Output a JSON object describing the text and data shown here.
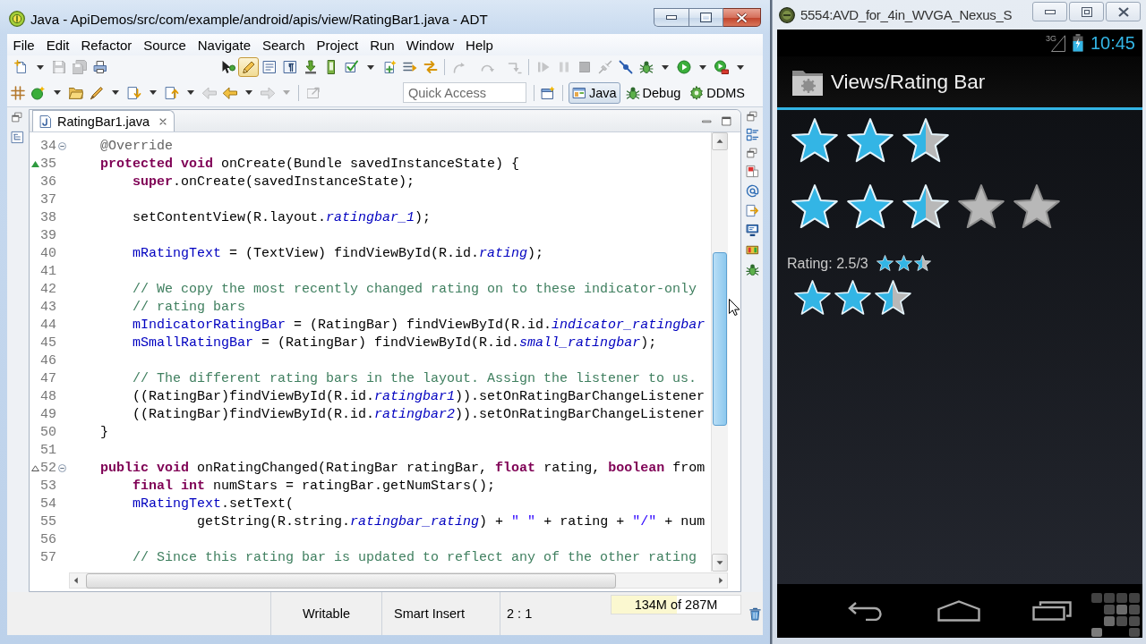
{
  "ide": {
    "title": "Java - ApiDemos/src/com/example/android/apis/view/RatingBar1.java - ADT",
    "menu": [
      "File",
      "Edit",
      "Refactor",
      "Source",
      "Navigate",
      "Search",
      "Project",
      "Run",
      "Window",
      "Help"
    ],
    "toolbar_rows": [
      {
        "groups": [
          {
            "items": [
              {
                "kind": "button",
                "disabled": false,
                "on": false
              },
              {
                "kind": "dropdown",
                "disabled": false,
                "on": false
              },
              {
                "kind": "button",
                "disabled": true,
                "on": false
              },
              {
                "kind": "button",
                "disabled": true,
                "on": false
              },
              {
                "kind": "button",
                "disabled": false,
                "on": false
              }
            ]
          },
          {
            "items": [
              {
                "kind": "button",
                "disabled": false,
                "on": false
              },
              {
                "kind": "button",
                "disabled": false,
                "on": true
              },
              {
                "kind": "button",
                "disabled": false,
                "on": false
              },
              {
                "kind": "button",
                "disabled": false,
                "on": false
              },
              {
                "kind": "button",
                "disabled": false,
                "on": false
              },
              {
                "kind": "button",
                "disabled": false,
                "on": false
              },
              {
                "kind": "button",
                "disabled": false,
                "on": false
              },
              {
                "kind": "dropdown",
                "disabled": false,
                "on": false
              },
              {
                "kind": "button",
                "disabled": false,
                "on": false
              },
              {
                "kind": "button",
                "disabled": false,
                "on": false
              },
              {
                "kind": "button",
                "disabled": false,
                "on": false
              }
            ]
          },
          {
            "items": [
              {
                "kind": "button",
                "disabled": true,
                "on": false
              },
              {
                "kind": "button",
                "disabled": true,
                "on": false
              },
              {
                "kind": "button",
                "disabled": true,
                "on": false
              }
            ]
          },
          {
            "items": [
              {
                "kind": "button",
                "disabled": true,
                "on": false
              },
              {
                "kind": "button",
                "disabled": true,
                "on": false
              },
              {
                "kind": "button",
                "disabled": true,
                "on": false
              },
              {
                "kind": "button",
                "disabled": true,
                "on": false
              },
              {
                "kind": "button",
                "disabled": false,
                "on": false
              },
              {
                "kind": "button",
                "disabled": false,
                "on": false
              },
              {
                "kind": "dropdown",
                "disabled": false,
                "on": false
              },
              {
                "kind": "button",
                "disabled": false,
                "on": false
              },
              {
                "kind": "dropdown",
                "disabled": false,
                "on": false
              },
              {
                "kind": "button",
                "disabled": false,
                "on": false
              },
              {
                "kind": "dropdown",
                "disabled": false,
                "on": false
              }
            ]
          }
        ]
      },
      {
        "groups": [
          {
            "items": [
              {
                "kind": "button",
                "disabled": false,
                "on": false
              },
              {
                "kind": "button",
                "disabled": false,
                "on": false
              },
              {
                "kind": "dropdown",
                "disabled": false,
                "on": false
              },
              {
                "kind": "button",
                "disabled": false,
                "on": false
              },
              {
                "kind": "button",
                "disabled": false,
                "on": false
              },
              {
                "kind": "dropdown",
                "disabled": false,
                "on": false
              },
              {
                "kind": "button",
                "disabled": false,
                "on": false
              },
              {
                "kind": "dropdown",
                "disabled": false,
                "on": false
              },
              {
                "kind": "button",
                "disabled": false,
                "on": false
              },
              {
                "kind": "dropdown",
                "disabled": false,
                "on": false
              },
              {
                "kind": "button",
                "disabled": true,
                "on": false
              },
              {
                "kind": "button",
                "disabled": false,
                "on": false
              },
              {
                "kind": "dropdown",
                "disabled": false,
                "on": false
              },
              {
                "kind": "button",
                "disabled": true,
                "on": false
              },
              {
                "kind": "dropdown",
                "disabled": true,
                "on": false
              }
            ]
          },
          {
            "items": [
              {
                "kind": "button",
                "disabled": true,
                "on": false
              }
            ]
          }
        ]
      }
    ],
    "quick_access": {
      "placeholder": "Quick Access"
    },
    "perspectives": [
      {
        "label": "Java",
        "selected": true
      },
      {
        "label": "Debug",
        "selected": false
      },
      {
        "label": "DDMS",
        "selected": false
      }
    ],
    "editor": {
      "tabs": [
        {
          "label": "RatingBar1.java",
          "selected": true
        }
      ],
      "lines": [
        {
          "number": "34",
          "overrides": false,
          "implements": false,
          "fold": true,
          "tokens": [
            {
              "kind": "annotation",
              "text": "    @Override"
            }
          ]
        },
        {
          "number": "35",
          "overrides": true,
          "implements": false,
          "fold": false,
          "tokens": [
            {
              "kind": "keyword",
              "text": "    protected void"
            },
            {
              "kind": "plain",
              "text": " onCreate(Bundle savedInstanceState) {"
            }
          ]
        },
        {
          "number": "36",
          "overrides": false,
          "implements": false,
          "fold": false,
          "tokens": [
            {
              "kind": "keyword",
              "text": "        super"
            },
            {
              "kind": "plain",
              "text": ".onCreate(savedInstanceState);"
            }
          ]
        },
        {
          "number": "37",
          "overrides": false,
          "implements": false,
          "fold": false
        },
        {
          "number": "38",
          "overrides": false,
          "implements": false,
          "fold": false,
          "tokens": [
            {
              "kind": "plain",
              "text": "        setContentView(R.layout."
            },
            {
              "kind": "constant",
              "text": "ratingbar_1"
            },
            {
              "kind": "plain",
              "text": ");"
            }
          ]
        },
        {
          "number": "39",
          "overrides": false,
          "implements": false,
          "fold": false
        },
        {
          "number": "40",
          "overrides": false,
          "implements": false,
          "fold": false,
          "tokens": [
            {
              "kind": "field",
              "text": "        mRatingText"
            },
            {
              "kind": "plain",
              "text": " = (TextView) findViewById(R.id."
            },
            {
              "kind": "constant",
              "text": "rating"
            },
            {
              "kind": "plain",
              "text": ");"
            }
          ]
        },
        {
          "number": "41",
          "overrides": false,
          "implements": false,
          "fold": false
        },
        {
          "number": "42",
          "overrides": false,
          "implements": false,
          "fold": false,
          "tokens": [
            {
              "kind": "comment",
              "text": "        // We copy the most recently changed rating on to these indicator-only"
            }
          ]
        },
        {
          "number": "43",
          "overrides": false,
          "implements": false,
          "fold": false,
          "tokens": [
            {
              "kind": "comment",
              "text": "        // rating bars"
            }
          ]
        },
        {
          "number": "44",
          "overrides": false,
          "implements": false,
          "fold": false,
          "tokens": [
            {
              "kind": "field",
              "text": "        mIndicatorRatingBar"
            },
            {
              "kind": "plain",
              "text": " = (RatingBar) findViewById(R.id."
            },
            {
              "kind": "constant",
              "text": "indicator_ratingbar"
            }
          ]
        },
        {
          "number": "45",
          "overrides": false,
          "implements": false,
          "fold": false,
          "tokens": [
            {
              "kind": "field",
              "text": "        mSmallRatingBar"
            },
            {
              "kind": "plain",
              "text": " = (RatingBar) findViewById(R.id."
            },
            {
              "kind": "constant",
              "text": "small_ratingbar"
            },
            {
              "kind": "plain",
              "text": ");"
            }
          ]
        },
        {
          "number": "46",
          "overrides": false,
          "implements": false,
          "fold": false
        },
        {
          "number": "47",
          "overrides": false,
          "implements": false,
          "fold": false,
          "tokens": [
            {
              "kind": "comment",
              "text": "        // The different rating bars in the layout. Assign the listener to us."
            }
          ]
        },
        {
          "number": "48",
          "overrides": false,
          "implements": false,
          "fold": false,
          "tokens": [
            {
              "kind": "plain",
              "text": "        ((RatingBar)findViewById(R.id."
            },
            {
              "kind": "constant",
              "text": "ratingbar1"
            },
            {
              "kind": "plain",
              "text": ")).setOnRatingBarChangeListener"
            }
          ]
        },
        {
          "number": "49",
          "overrides": false,
          "implements": false,
          "fold": false,
          "tokens": [
            {
              "kind": "plain",
              "text": "        ((RatingBar)findViewById(R.id."
            },
            {
              "kind": "constant",
              "text": "ratingbar2"
            },
            {
              "kind": "plain",
              "text": ")).setOnRatingBarChangeListener"
            }
          ]
        },
        {
          "number": "50",
          "overrides": false,
          "implements": false,
          "fold": false,
          "tokens": [
            {
              "kind": "plain",
              "text": "    }"
            }
          ]
        },
        {
          "number": "51",
          "overrides": false,
          "implements": false,
          "fold": false
        },
        {
          "number": "52",
          "overrides": false,
          "implements": true,
          "fold": true,
          "tokens": [
            {
              "kind": "keyword",
              "text": "    public void"
            },
            {
              "kind": "plain",
              "text": " onRatingChanged(RatingBar ratingBar, "
            },
            {
              "kind": "keyword",
              "text": "float"
            },
            {
              "kind": "plain",
              "text": " rating, "
            },
            {
              "kind": "keyword",
              "text": "boolean"
            },
            {
              "kind": "plain",
              "text": " from"
            }
          ]
        },
        {
          "number": "53",
          "overrides": false,
          "implements": false,
          "fold": false,
          "tokens": [
            {
              "kind": "keyword",
              "text": "        final int"
            },
            {
              "kind": "plain",
              "text": " numStars = ratingBar.getNumStars();"
            }
          ]
        },
        {
          "number": "54",
          "overrides": false,
          "implements": false,
          "fold": false,
          "tokens": [
            {
              "kind": "field",
              "text": "        mRatingText"
            },
            {
              "kind": "plain",
              "text": ".setText("
            }
          ]
        },
        {
          "number": "55",
          "overrides": false,
          "implements": false,
          "fold": false,
          "tokens": [
            {
              "kind": "plain",
              "text": "                getString(R.string."
            },
            {
              "kind": "constant",
              "text": "ratingbar_rating"
            },
            {
              "kind": "plain",
              "text": ") + "
            },
            {
              "kind": "string",
              "text": "\" \""
            },
            {
              "kind": "plain",
              "text": " + rating + "
            },
            {
              "kind": "string",
              "text": "\"/\""
            },
            {
              "kind": "plain",
              "text": " + num"
            }
          ]
        },
        {
          "number": "56",
          "overrides": false,
          "implements": false,
          "fold": false
        },
        {
          "number": "57",
          "overrides": false,
          "implements": false,
          "fold": false,
          "tokens": [
            {
              "kind": "comment",
              "text": "        // Since this rating bar is updated to reflect any of the other rating"
            }
          ]
        }
      ]
    },
    "status_bar": {
      "mode": "Writable",
      "insert_mode": "Smart Insert",
      "position": "2 : 1",
      "heap": {
        "text": "134M of 287M",
        "level": 0.51
      }
    }
  },
  "emulator": {
    "title": "5554:AVD_for_4in_WVGA_Nexus_S",
    "status_bar": {
      "network": "3G",
      "time": "10:45"
    },
    "action_bar": {
      "title": "Views/Rating Bar"
    },
    "rating_bars": [
      {
        "kind": "three",
        "stars": 2.5
      },
      {
        "kind": "five",
        "stars": 2.5
      }
    ],
    "rating_label": "Rating: 2.5/3",
    "small_bar": {
      "kind": "three",
      "stars": 2.5
    },
    "indicator_bar": {
      "kind": "three",
      "stars": 2.5
    }
  }
}
